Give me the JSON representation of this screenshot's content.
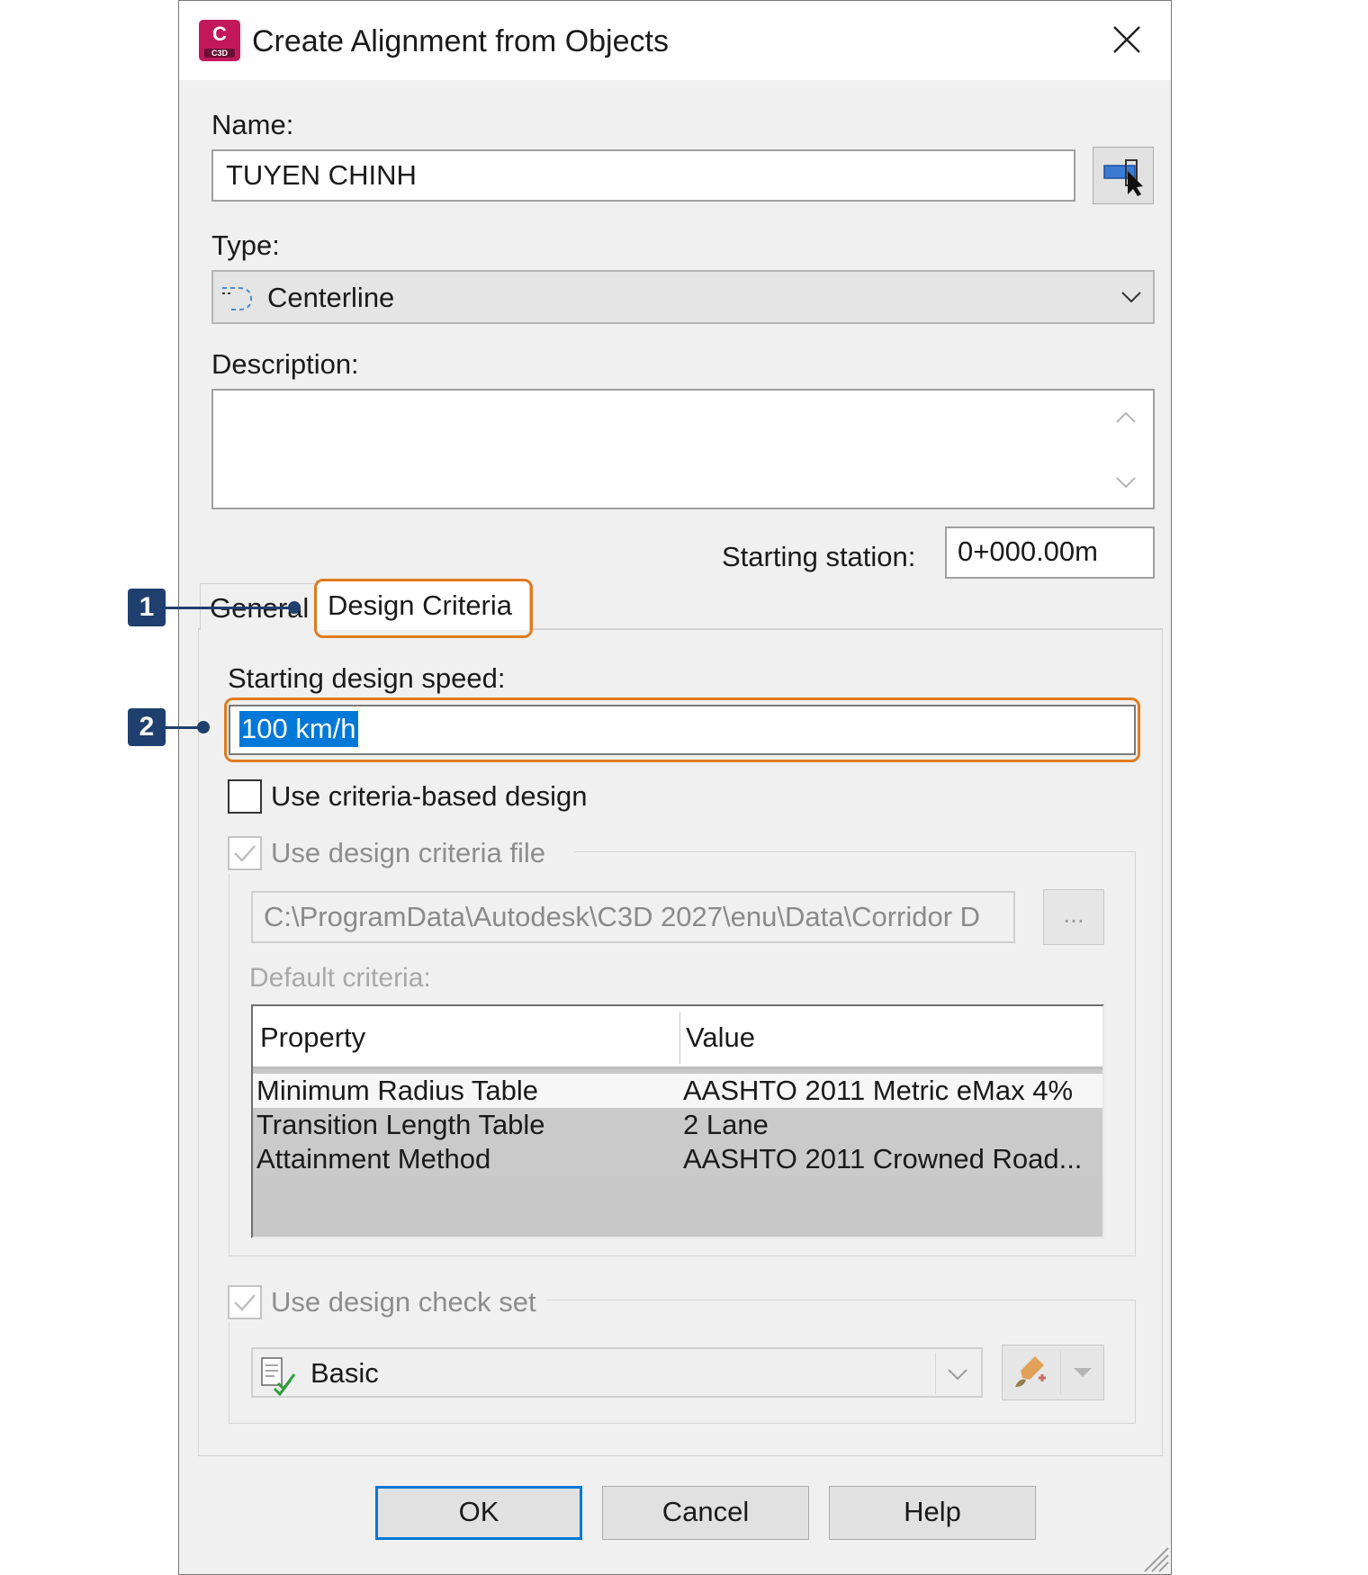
{
  "dialog": {
    "title": "Create Alignment from Objects",
    "icon": {
      "name": "civil3d-app-icon",
      "letter": "C",
      "sublabel": "C3D",
      "color": "#c2185b"
    }
  },
  "name": {
    "label": "Name:",
    "value": "TUYEN CHINH"
  },
  "type": {
    "label": "Type:",
    "value": "Centerline"
  },
  "description": {
    "label": "Description:",
    "value": ""
  },
  "starting_station": {
    "label": "Starting station:",
    "value": "0+000.00m"
  },
  "tabs": [
    {
      "label": "General",
      "active": false
    },
    {
      "label": "Design Criteria",
      "active": true
    }
  ],
  "design_speed": {
    "label": "Starting design speed:",
    "value": "100 km/h"
  },
  "criteria_based": {
    "label": "Use criteria-based design",
    "checked": false
  },
  "criteria_file": {
    "label": "Use design criteria file",
    "checked": true,
    "enabled": false,
    "path": "C:\\ProgramData\\Autodesk\\C3D 2027\\enu\\Data\\Corridor D",
    "browse_label": "..."
  },
  "default_criteria": {
    "label": "Default criteria:",
    "columns": [
      "Property",
      "Value"
    ],
    "rows": [
      {
        "property": "Minimum Radius Table",
        "value": "AASHTO 2011 Metric eMax 4%"
      },
      {
        "property": "Transition Length Table",
        "value": "2 Lane"
      },
      {
        "property": "Attainment Method",
        "value": "AASHTO 2011 Crowned Road..."
      }
    ]
  },
  "check_set": {
    "label": "Use design check set",
    "checked": true,
    "enabled": false,
    "value": "Basic"
  },
  "buttons": {
    "ok": "OK",
    "cancel": "Cancel",
    "help": "Help"
  },
  "callouts": [
    {
      "number": "1"
    },
    {
      "number": "2"
    }
  ],
  "colors": {
    "callout": "#e07b1f",
    "badge": "#1f3f6e",
    "selection": "#0078d7",
    "accent": "#c2185b"
  }
}
